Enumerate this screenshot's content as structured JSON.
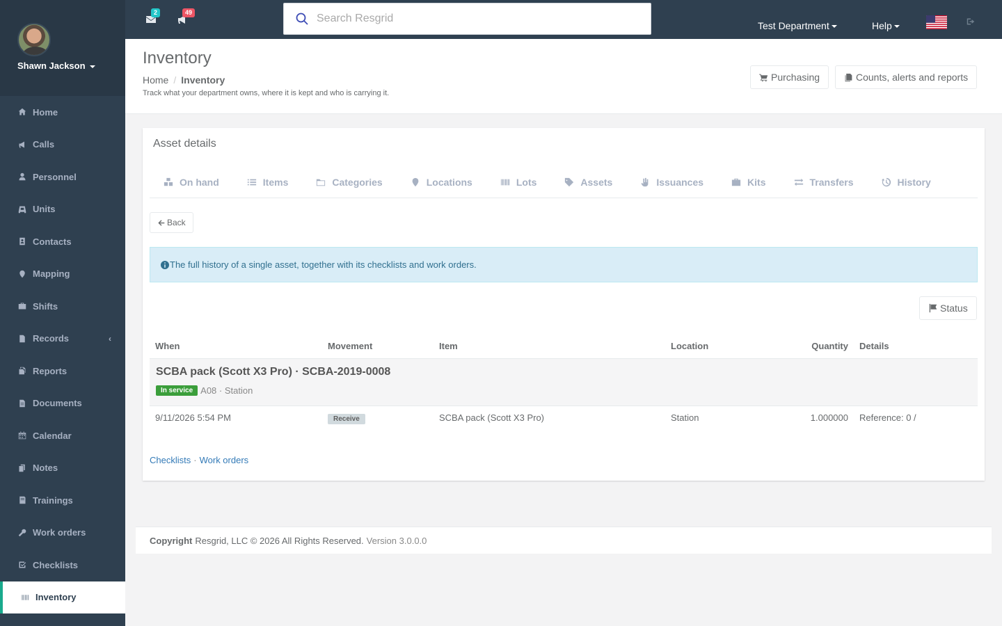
{
  "sidebar": {
    "user_name": "Shawn Jackson",
    "items": [
      {
        "label": "Home",
        "icon": "home-icon"
      },
      {
        "label": "Calls",
        "icon": "bullhorn-icon"
      },
      {
        "label": "Personnel",
        "icon": "user-icon"
      },
      {
        "label": "Units",
        "icon": "truck-icon"
      },
      {
        "label": "Contacts",
        "icon": "contact-icon"
      },
      {
        "label": "Mapping",
        "icon": "map-marker-icon"
      },
      {
        "label": "Shifts",
        "icon": "briefcase-icon"
      },
      {
        "label": "Records",
        "icon": "file-icon"
      },
      {
        "label": "Reports",
        "icon": "report-icon"
      },
      {
        "label": "Documents",
        "icon": "document-icon"
      },
      {
        "label": "Calendar",
        "icon": "calendar-icon"
      },
      {
        "label": "Notes",
        "icon": "notes-icon"
      },
      {
        "label": "Trainings",
        "icon": "trainings-icon"
      },
      {
        "label": "Work orders",
        "icon": "wrench-icon"
      },
      {
        "label": "Checklists",
        "icon": "checklist-icon"
      },
      {
        "label": "Inventory",
        "icon": "barcode-icon"
      }
    ],
    "active": "Inventory"
  },
  "topbar": {
    "messages_count": "2",
    "notifications_count": "49",
    "search_placeholder": "Search Resgrid",
    "department": "Test Department",
    "help": "Help"
  },
  "heading": {
    "title": "Inventory",
    "breadcrumb_home": "Home",
    "breadcrumb_current": "Inventory",
    "description": "Track what your department owns, where it is kept and who is carrying it.",
    "purchasing_label": "Purchasing",
    "counts_label": "Counts, alerts and reports"
  },
  "main": {
    "box_title": "Asset details",
    "tabs": [
      {
        "label": "On hand",
        "icon": "cubes-icon"
      },
      {
        "label": "Items",
        "icon": "list-icon"
      },
      {
        "label": "Categories",
        "icon": "folder-icon"
      },
      {
        "label": "Locations",
        "icon": "map-marker-icon"
      },
      {
        "label": "Lots",
        "icon": "barcode-icon"
      },
      {
        "label": "Assets",
        "icon": "tag-icon"
      },
      {
        "label": "Issuances",
        "icon": "hand-icon"
      },
      {
        "label": "Kits",
        "icon": "briefcase-icon"
      },
      {
        "label": "Transfers",
        "icon": "exchange-icon"
      },
      {
        "label": "History",
        "icon": "history-icon"
      }
    ],
    "back_label": "Back",
    "info_text": "The full history of a single asset, together with its checklists and work orders.",
    "status_label": "Status",
    "table": {
      "headers": [
        "When",
        "Movement",
        "Item",
        "Location",
        "Quantity",
        "Details"
      ],
      "group": {
        "title": "SCBA pack (Scott X3 Pro) · SCBA-2019-0008",
        "status": "In service",
        "sub": "A08 · Station"
      },
      "rows": [
        {
          "when": "9/11/2026 5:54 PM",
          "movement": "Receive",
          "item": "SCBA pack (Scott X3 Pro)",
          "location": "Station",
          "quantity": "1.000000",
          "details": "Reference: 0 /"
        }
      ]
    },
    "links": {
      "checklists": "Checklists",
      "separator": "·",
      "work_orders": "Work orders"
    }
  },
  "footer": {
    "copyright": "Copyright",
    "text": "Resgrid, LLC © 2026 All Rights Reserved.",
    "version": "Version 3.0.0.0"
  },
  "colors": {
    "sidebar": "#2f4050",
    "active_accent": "#19aa8d",
    "in_service": "#3b9e3b",
    "info_bg": "#d9edf7"
  }
}
